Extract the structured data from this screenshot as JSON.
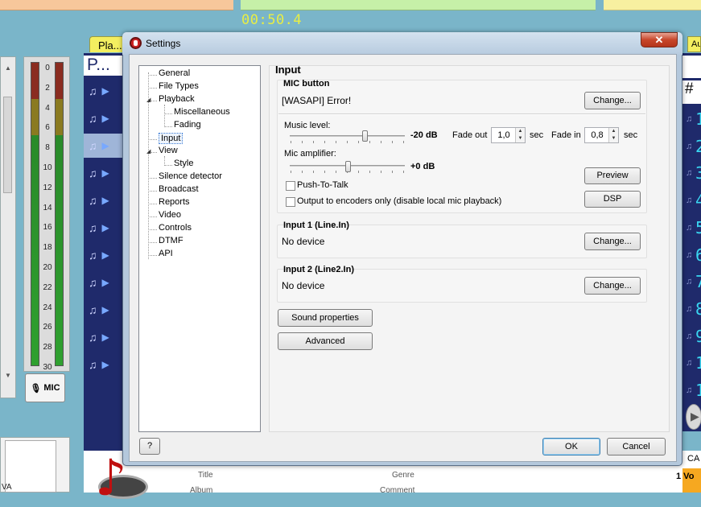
{
  "app": {
    "timer": "00:50.4",
    "vu_scale": [
      "0",
      "2",
      "4",
      "6",
      "8",
      "10",
      "12",
      "14",
      "16",
      "18",
      "20",
      "22",
      "24",
      "26",
      "28",
      "30"
    ],
    "mic_label": "MIC",
    "playlist_tab": "Pla...",
    "playlist_header": "P...",
    "right_tab": "Au",
    "right_hash": "#",
    "right_numbers": [
      "1",
      "2",
      "3",
      "4",
      "5",
      "6",
      "7",
      "8",
      "9",
      "1",
      "1"
    ],
    "bottom_labels": {
      "title": "Title",
      "genre": "Genre",
      "album": "Album",
      "comment": "Comment"
    },
    "bottom_left_text": "VA",
    "right_bottom_top": "CA",
    "right_bottom_text": "1 Vo",
    "colors": {
      "playlist_bg": "#1f2a6b",
      "number_cyan": "#39d7f2",
      "desktop": "#7ab5c9"
    }
  },
  "dialog": {
    "title": "Settings",
    "close_glyph": "✕",
    "tree": [
      {
        "label": "General",
        "level": 0
      },
      {
        "label": "File Types",
        "level": 0
      },
      {
        "label": "Playback",
        "level": 0,
        "expanded": true
      },
      {
        "label": "Miscellaneous",
        "level": 1
      },
      {
        "label": "Fading",
        "level": 1
      },
      {
        "label": "Input",
        "level": 0,
        "selected": true
      },
      {
        "label": "View",
        "level": 0,
        "expanded": true
      },
      {
        "label": "Style",
        "level": 1
      },
      {
        "label": "Silence detector",
        "level": 0
      },
      {
        "label": "Broadcast",
        "level": 0
      },
      {
        "label": "Reports",
        "level": 0
      },
      {
        "label": "Video",
        "level": 0
      },
      {
        "label": "Controls",
        "level": 0
      },
      {
        "label": "DTMF",
        "level": 0
      },
      {
        "label": "API",
        "level": 0
      }
    ],
    "page_title": "Input",
    "mic": {
      "heading": "MIC button",
      "device": "[WASAPI] Error!",
      "change": "Change...",
      "music_level_label": "Music level:",
      "music_level_value": "-20 dB",
      "music_level_pct": 0.65,
      "fade_out_label": "Fade out",
      "fade_out_value": "1,0",
      "fade_in_label": "Fade in",
      "fade_in_value": "0,8",
      "sec": "sec",
      "mic_amp_label": "Mic amplifier:",
      "mic_amp_value": "+0 dB",
      "mic_amp_pct": 0.5,
      "push_to_talk": "Push-To-Talk",
      "output_encoders": "Output to encoders only (disable local mic playback)",
      "preview": "Preview",
      "dsp": "DSP"
    },
    "input1": {
      "heading": "Input 1 (Line.In)",
      "device": "No device",
      "change": "Change..."
    },
    "input2": {
      "heading": "Input 2 (Line2.In)",
      "device": "No device",
      "change": "Change..."
    },
    "sound_properties": "Sound properties",
    "advanced": "Advanced",
    "help": "?",
    "ok": "OK",
    "cancel": "Cancel"
  }
}
